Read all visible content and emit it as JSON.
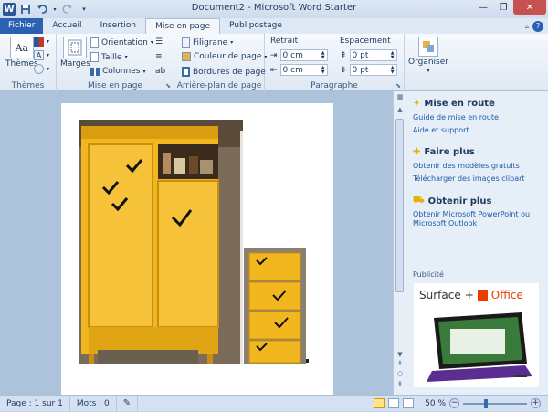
{
  "window": {
    "title": "Document2 - Microsoft Word Starter",
    "app_icon_letter": "W"
  },
  "tabs": [
    {
      "label": "Fichier"
    },
    {
      "label": "Accueil"
    },
    {
      "label": "Insertion"
    },
    {
      "label": "Mise en page"
    },
    {
      "label": "Publipostage"
    }
  ],
  "ribbon": {
    "themes": {
      "themes_label": "Thèmes",
      "group_label": "Thèmes"
    },
    "page_setup": {
      "margins_label": "Marges",
      "orientation_label": "Orientation",
      "size_label": "Taille",
      "columns_label": "Colonnes",
      "group_label": "Mise en page"
    },
    "background": {
      "watermark_label": "Filigrane",
      "page_color_label": "Couleur de page",
      "borders_label": "Bordures de page",
      "group_label": "Arrière-plan de page"
    },
    "paragraph": {
      "indent_header": "Retrait",
      "spacing_header": "Espacement",
      "indent_left": "0 cm",
      "indent_right": "0 cm",
      "spacing_before": "0 pt",
      "spacing_after": "0 pt",
      "group_label": "Paragraphe"
    },
    "arrange": {
      "arrange_label": "Organiser"
    }
  },
  "panel": {
    "sections": [
      {
        "header": "Mise en route",
        "links": [
          "Guide de mise en route",
          "Aide et support"
        ]
      },
      {
        "header": "Faire plus",
        "links": [
          "Obtenir des modèles gratuits",
          "Télécharger des images clipart"
        ]
      },
      {
        "header": "Obtenir plus",
        "links": [
          "Obtenir Microsoft PowerPoint ou Microsoft Outlook"
        ]
      }
    ],
    "ad_label": "Publicité",
    "ad_text_left": "Surface",
    "ad_plus": "+",
    "ad_text_right": "Office"
  },
  "status": {
    "page": "Page : 1 sur 1",
    "words": "Mots : 0",
    "zoom": "50 %"
  },
  "colors": {
    "file_tab": "#2a61b2",
    "cabinet": "#f2b71e",
    "office_orange": "#eb3c00"
  }
}
